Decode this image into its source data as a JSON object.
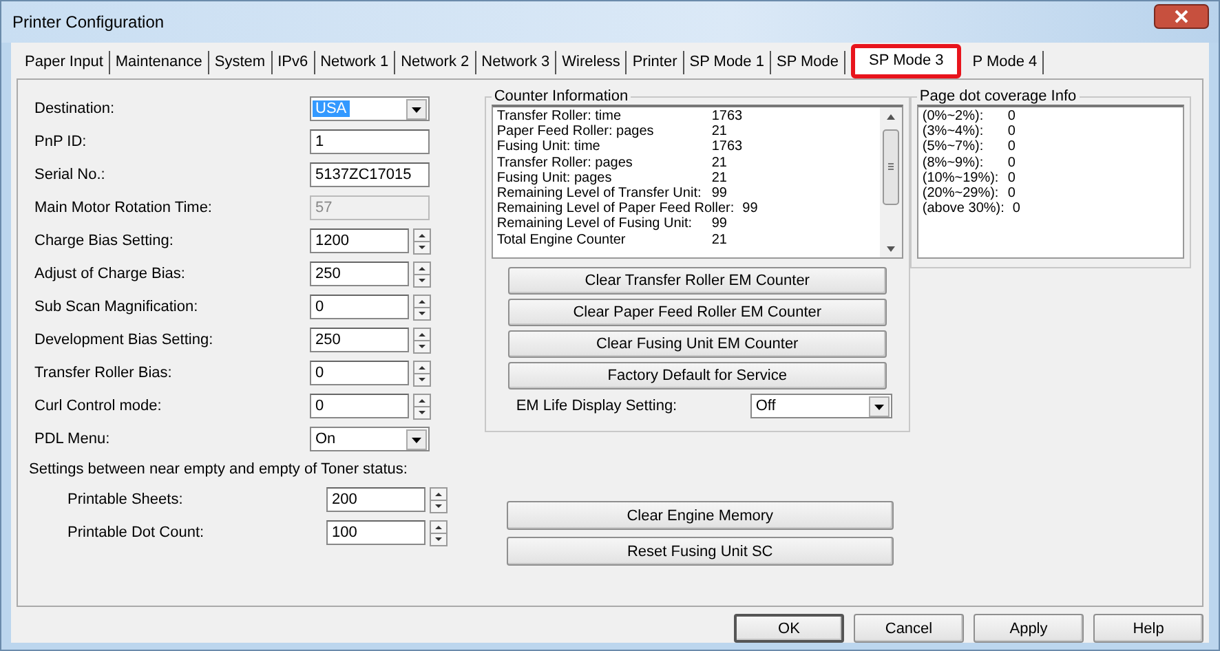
{
  "window": {
    "title": "Printer Configuration"
  },
  "tabs": [
    {
      "label": "Paper Input",
      "selected": false
    },
    {
      "label": "Maintenance",
      "selected": false
    },
    {
      "label": "System",
      "selected": false
    },
    {
      "label": "IPv6",
      "selected": false
    },
    {
      "label": "Network 1",
      "selected": false
    },
    {
      "label": "Network 2",
      "selected": false
    },
    {
      "label": "Network 3",
      "selected": false
    },
    {
      "label": "Wireless",
      "selected": false
    },
    {
      "label": "Printer",
      "selected": false
    },
    {
      "label": "SP Mode 1",
      "selected": false
    },
    {
      "label": "SP Mode",
      "selected": false
    },
    {
      "label": "SP Mode 3",
      "selected": true
    },
    {
      "label": "P Mode 4",
      "selected": false
    }
  ],
  "settings": [
    {
      "kind": "combo",
      "label": "Destination:",
      "value": "USA",
      "highlighted": true
    },
    {
      "kind": "text",
      "label": "PnP ID:",
      "value": "1"
    },
    {
      "kind": "text",
      "label": "Serial No.:",
      "value": "5137ZC17015"
    },
    {
      "kind": "readonly",
      "label": "Main Motor Rotation Time:",
      "value": "57"
    },
    {
      "kind": "spin",
      "label": "Charge Bias Setting:",
      "value": "1200"
    },
    {
      "kind": "spin",
      "label": "Adjust of Charge Bias:",
      "value": "250"
    },
    {
      "kind": "spin",
      "label": "Sub Scan Magnification:",
      "value": "0"
    },
    {
      "kind": "spin",
      "label": "Development Bias Setting:",
      "value": "250"
    },
    {
      "kind": "spin",
      "label": "Transfer Roller Bias:",
      "value": "0"
    },
    {
      "kind": "spin",
      "label": "Curl Control mode:",
      "value": "0"
    },
    {
      "kind": "combo",
      "label": "PDL Menu:",
      "value": "On",
      "highlighted": false
    }
  ],
  "toner": {
    "heading": "Settings between near empty and empty of Toner status:",
    "fields": [
      {
        "kind": "spin",
        "label": "Printable Sheets:",
        "value": "200"
      },
      {
        "kind": "spin",
        "label": "Printable Dot Count:",
        "value": "100"
      }
    ]
  },
  "counter_information": {
    "title": "Counter Information",
    "items": [
      {
        "label": "Transfer Roller: time",
        "value": "1763"
      },
      {
        "label": "Paper Feed Roller: pages",
        "value": "21"
      },
      {
        "label": "Fusing Unit: time",
        "value": "1763"
      },
      {
        "label": "Transfer Roller: pages",
        "value": "21"
      },
      {
        "label": "Fusing Unit: pages",
        "value": "21"
      },
      {
        "label": "Remaining Level of Transfer Unit:",
        "value": "99"
      },
      {
        "label": "Remaining Level of Paper Feed Roller:",
        "value": "99"
      },
      {
        "label": "Remaining Level of Fusing Unit:",
        "value": "99"
      },
      {
        "label": "Total Engine Counter",
        "value": "21"
      }
    ],
    "buttons": [
      "Clear Transfer Roller EM Counter",
      "Clear Paper Feed Roller EM Counter",
      "Clear Fusing Unit EM Counter",
      "Factory Default for Service"
    ],
    "em_life": {
      "kind": "combo",
      "label": "EM Life Display Setting:",
      "value": "Off",
      "highlighted": false
    }
  },
  "engine_buttons": [
    "Clear Engine Memory",
    "Reset Fusing Unit SC"
  ],
  "page_dot_coverage": {
    "title": "Page dot coverage Info",
    "items": [
      {
        "label": "(0%~2%):",
        "value": "0"
      },
      {
        "label": "(3%~4%):",
        "value": "0"
      },
      {
        "label": "(5%~7%):",
        "value": "0"
      },
      {
        "label": "(8%~9%):",
        "value": "0"
      },
      {
        "label": "(10%~19%):",
        "value": "0"
      },
      {
        "label": "(20%~29%):",
        "value": "0"
      },
      {
        "label": "(above 30%):",
        "value": "0"
      }
    ]
  },
  "dialog_buttons": [
    {
      "label": "OK",
      "default": true
    },
    {
      "label": "Cancel",
      "default": false
    },
    {
      "label": "Apply",
      "default": false
    },
    {
      "label": "Help",
      "default": false
    }
  ]
}
